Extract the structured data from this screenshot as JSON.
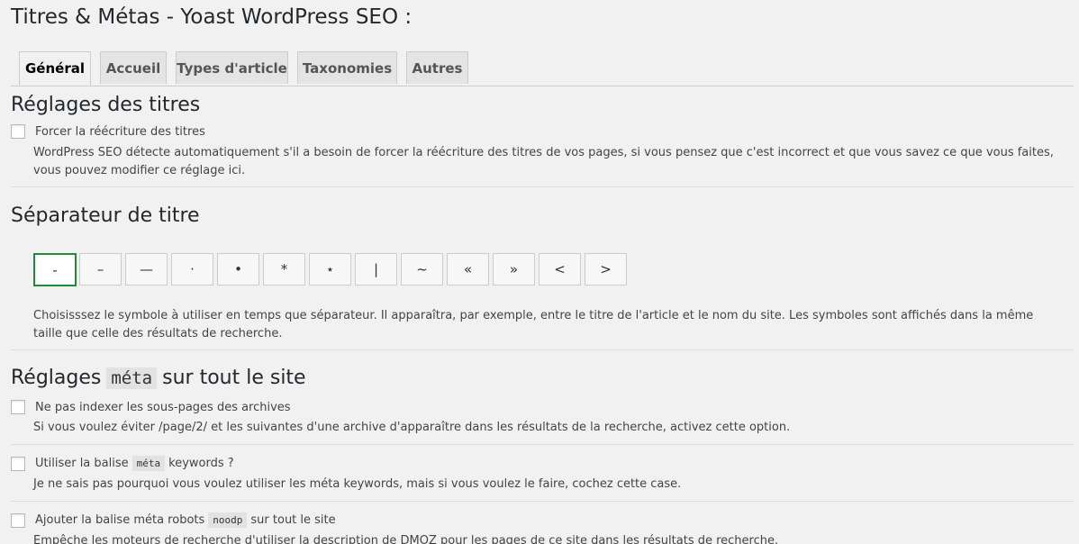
{
  "page": {
    "title": "Titres & Métas - Yoast WordPress SEO :"
  },
  "tabs": [
    {
      "label": "Général",
      "active": true
    },
    {
      "label": "Accueil",
      "active": false
    },
    {
      "label": "Types d'article",
      "active": false
    },
    {
      "label": "Taxonomies",
      "active": false
    },
    {
      "label": "Autres",
      "active": false
    }
  ],
  "titles_section": {
    "heading": "Réglages des titres",
    "force_rewrite": {
      "label": "Forcer la réécriture des titres",
      "checked": false,
      "description": "WordPress SEO détecte automatiquement s'il a besoin de forcer la réécriture des titres de vos pages, si vous pensez que c'est incorrect et que vous savez ce que vous faites, vous pouvez modifier ce réglage ici."
    }
  },
  "separator_section": {
    "heading": "Séparateur de titre",
    "options": [
      "-",
      "–",
      "—",
      "·",
      "•",
      "*",
      "⋆",
      "|",
      "~",
      "«",
      "»",
      "<",
      ">"
    ],
    "selected_index": 0,
    "description": "Choisisssez le symbole à utiliser en temps que séparateur. Il apparaîtra, par exemple, entre le titre de l'article et le nom du site. Les symboles sont affichés dans la même taille que celle des résultats de recherche."
  },
  "meta_section": {
    "heading_before": "Réglages",
    "heading_code": "méta",
    "heading_after": "sur tout le site",
    "noindex_subpages": {
      "label": "Ne pas indexer les sous-pages des archives",
      "checked": false,
      "description": "Si vous voulez éviter /page/2/ et les suivantes d'une archive d'apparaître dans les résultats de la recherche, activez cette option."
    },
    "meta_keywords": {
      "label_before": "Utiliser la balise",
      "label_code": "méta",
      "label_after": "keywords ?",
      "checked": false,
      "description": "Je ne sais pas pourquoi vous voulez utiliser les méta keywords, mais si vous voulez le faire, cochez cette case."
    },
    "noodp": {
      "label_before": "Ajouter la balise méta robots",
      "label_code": "noodp",
      "label_after": "sur tout le site",
      "checked": false,
      "description": "Empêche les moteurs de recherche d'utiliser la description de DMOZ pour les pages de ce site dans les résultats de recherche."
    }
  },
  "colors": {
    "background": "#f1f1f1",
    "selected_border": "#1e8a3a"
  }
}
